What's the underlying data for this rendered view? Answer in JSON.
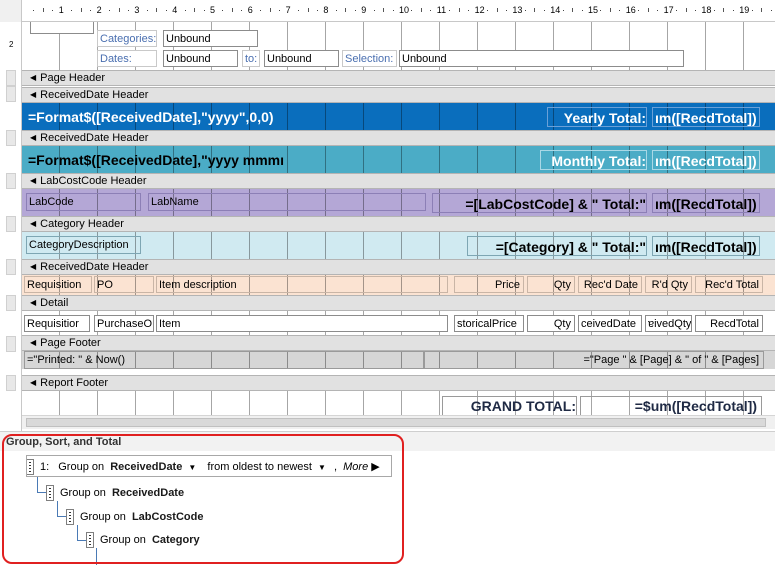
{
  "ruler": {
    "numbers": [
      "1",
      "2",
      "3",
      "4",
      "5",
      "6",
      "7",
      "8",
      "9",
      "10",
      "11",
      "12",
      "13",
      "14",
      "15",
      "16",
      "17",
      "18",
      "19"
    ]
  },
  "vruler": {
    "numbers": [
      "2"
    ]
  },
  "report_header": {
    "categories_label": "Categories:",
    "categories_value": "Unbound",
    "dates_label": "Dates:",
    "dates_value": "Unbound",
    "to_label": "to:",
    "to_value": "Unbound",
    "selection_label": "Selection:",
    "selection_value": "Unbound"
  },
  "sections": {
    "page_header": "Page Header",
    "received_header_1": "ReceivedDate Header",
    "received_header_2": "ReceivedDate Header",
    "labcost_header": "LabCostCode Header",
    "category_header": "Category Header",
    "received_header_3": "ReceivedDate Header",
    "detail": "Detail",
    "page_footer": "Page Footer",
    "report_footer": "Report Footer"
  },
  "yearly_band": {
    "expr": "=Format$([ReceivedDate],\"yyyy\",0,0)",
    "total_label": "Yearly Total:",
    "total_expr": "ım([RecdTotal])"
  },
  "monthly_band": {
    "expr": "=Format$([ReceivedDate],\"yyyy mmmı",
    "total_label": "Monthly Total:",
    "total_expr": "ım([RecdTotal])"
  },
  "labcost_band": {
    "code": "LabCode",
    "name": "LabName",
    "total_label": "=[LabCostCode] & \" Total:\"",
    "total_expr": "ım([RecdTotal])"
  },
  "category_band": {
    "desc": "CategoryDescription",
    "total_label": "=[Category] & \" Total:\"",
    "total_expr": "ım([RecdTotal])"
  },
  "column_labels": [
    "Requisition",
    "PO",
    "Item description",
    "Price",
    "Qty",
    "Rec'd Date",
    "R'd Qty",
    "Rec'd Total"
  ],
  "detail_fields": [
    "Requisitior",
    "PurchaseO",
    "Item",
    "storicalPrice",
    "Qty",
    "ceivedDate",
    "ɐivedQty",
    "RecdTotal"
  ],
  "page_footer": {
    "printed": "=\"Printed: \" & Now()",
    "page": "=\"Page \" & [Page] & \" of \" & [Pages]"
  },
  "report_footer": {
    "grand_label": "GRAND TOTAL:",
    "grand_expr": "=$um([RecdTotal])"
  },
  "gst": {
    "title": "Group, Sort, and Total",
    "row1": {
      "index": "1:",
      "group_on": "Group on",
      "field": "ReceivedDate",
      "order": "from oldest to newest",
      "more": "More ▶"
    },
    "row2": {
      "group_on": "Group on",
      "field": "ReceivedDate"
    },
    "row3": {
      "group_on": "Group on",
      "field": "LabCostCode"
    },
    "row4": {
      "group_on": "Group on",
      "field": "Category"
    }
  },
  "colors": {
    "yearly_band": "#0a6ebd",
    "monthly_band": "#4bacc6",
    "labcost_band": "#b4a7d6",
    "category_band": "#d0eaf1",
    "column_band": "#fbe3d2",
    "footer_band": "#d6d6d6",
    "highlight_box": "#e02020"
  }
}
